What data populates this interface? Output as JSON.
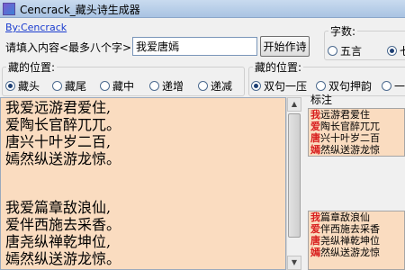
{
  "window": {
    "title": "Cencrack_藏头诗生成器"
  },
  "top": {
    "link": "By:Cencrack",
    "input_label": "请填入内容<最多八个字>:",
    "input_value": "我爱唐嫣",
    "generate_button": "开始作诗"
  },
  "chars_group": {
    "legend": "字数:",
    "options": [
      "五言",
      "七"
    ],
    "selected": 1
  },
  "position_group": {
    "legend": "藏的位置:",
    "options": [
      "藏头",
      "藏尾",
      "藏中",
      "递增",
      "递减"
    ],
    "selected": 0
  },
  "rhyme_group": {
    "legend": "藏的位置:",
    "options": [
      "双句一压",
      "双句押韵",
      "一三"
    ],
    "selected": 0
  },
  "poems": [
    [
      "我爱远游君爱住,",
      "爱陶长官醉兀兀。",
      "唐兴十叶岁二百,",
      "嫣然纵送游龙惊。"
    ],
    [
      "我爱篇章敌浪仙,",
      "爱伴西施去采香。",
      "唐尧纵禅乾坤位,",
      "嫣然纵送游龙惊。"
    ]
  ],
  "annotation": {
    "label": "标注"
  },
  "annotated_poems": [
    {
      "highlight": "我爱唐嫣",
      "lines": [
        "远游君爱住",
        "陶长官醉兀兀",
        "兴十叶岁二百",
        "然纵送游龙惊"
      ]
    },
    {
      "highlight": "我爱唐嫣",
      "lines": [
        "篇章敌浪仙",
        "伴西施去采香",
        "尧纵禅乾坤位",
        "然纵送游龙惊"
      ]
    }
  ],
  "colors": {
    "text_background": "#fadcc0",
    "highlight": "#d81e1e",
    "link": "#1a3ccf"
  }
}
